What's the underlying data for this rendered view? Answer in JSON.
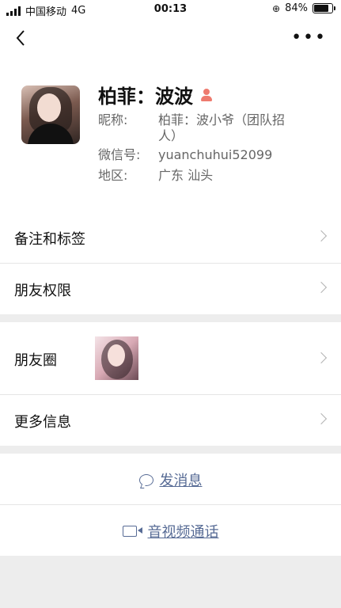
{
  "status_bar": {
    "carrier": "中国移动",
    "network": "4G",
    "time": "00:13",
    "battery_percent": "84%"
  },
  "nav": {
    "back_icon": "chevron-left-icon",
    "more_icon": "ellipsis-icon"
  },
  "profile": {
    "name": "柏菲：波波",
    "nickname_label": "昵称:",
    "nickname_value": "柏菲：波小爷（团队招人）",
    "wechat_label": "微信号:",
    "wechat_value": "yuanchuhui52099",
    "region_label": "地区:",
    "region_value": "广东 汕头"
  },
  "rows": {
    "remarks_tags": "备注和标签",
    "friend_permissions": "朋友权限",
    "moments": "朋友圈",
    "more_info": "更多信息"
  },
  "actions": {
    "send_message": "发消息",
    "av_call": "音视频通话"
  },
  "colors": {
    "link": "#576b95",
    "background": "#ededed",
    "badge": "#ee7a6e"
  }
}
